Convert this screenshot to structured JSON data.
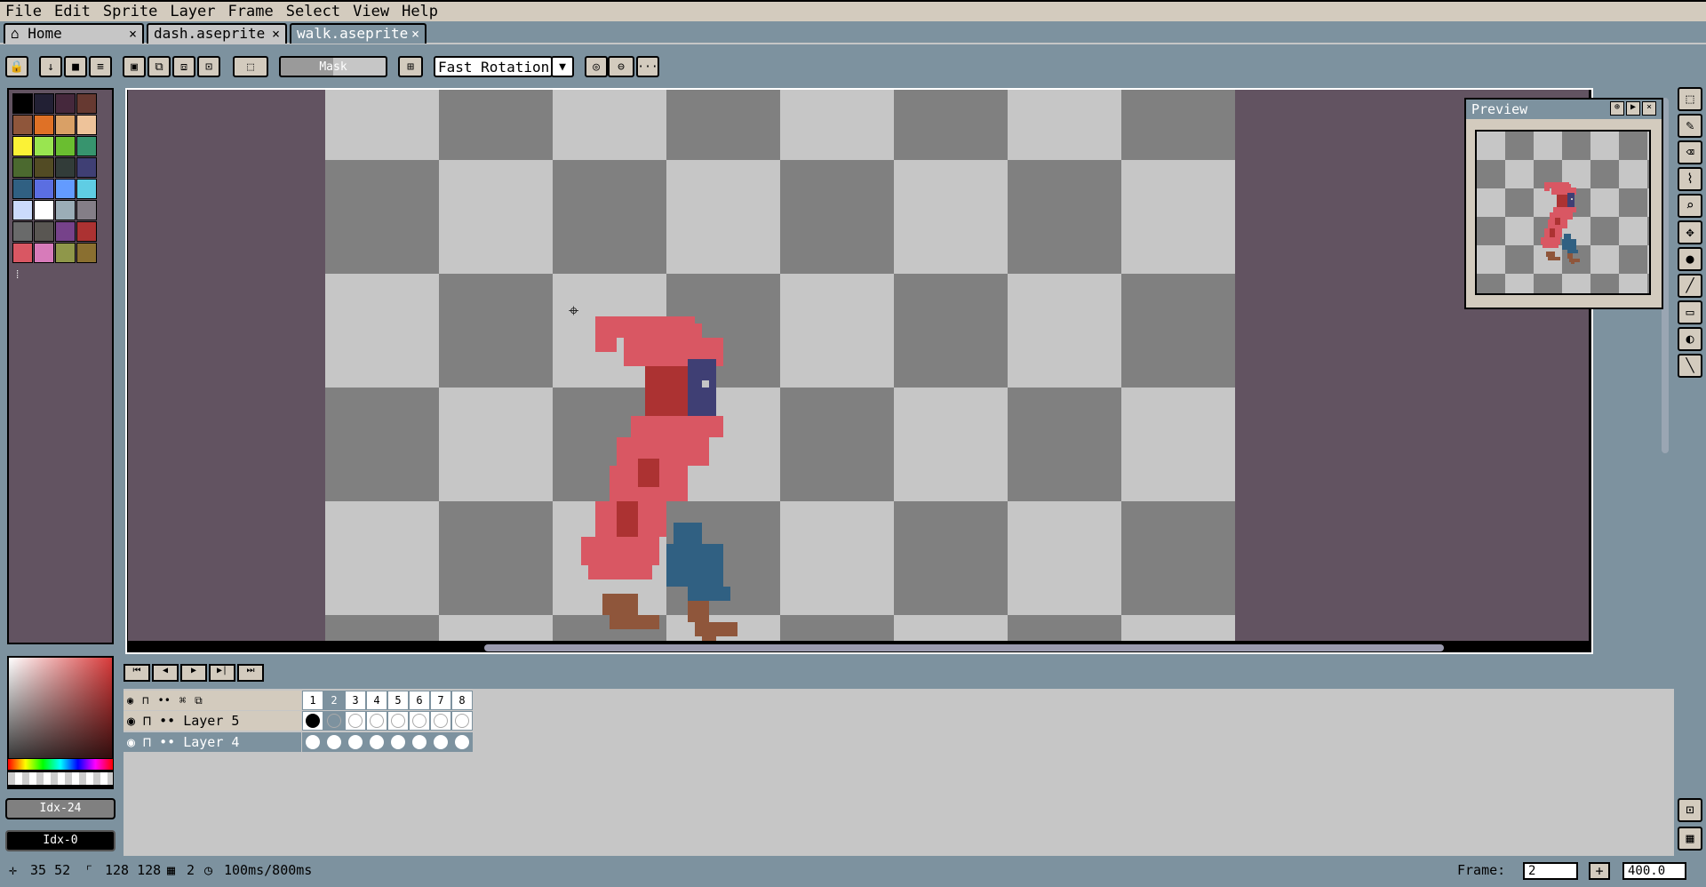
{
  "menu": [
    "File",
    "Edit",
    "Sprite",
    "Layer",
    "Frame",
    "Select",
    "View",
    "Help"
  ],
  "tabs": [
    {
      "label": "Home",
      "icon": "home-icon",
      "close": "×"
    },
    {
      "label": "dash.aseprite",
      "close": "×"
    },
    {
      "label": "walk.aseprite",
      "close": "×",
      "active": true
    }
  ],
  "toolbar": {
    "mask_label": "Mask",
    "rotation_value": "Fast Rotation",
    "more_label": "···"
  },
  "preview": {
    "title": "Preview"
  },
  "palette_colors": [
    "#000000",
    "#222034",
    "#45283c",
    "#663931",
    "#8f563b",
    "#df7126",
    "#d9a066",
    "#eec39a",
    "#fbf236",
    "#99e550",
    "#6abe30",
    "#37946e",
    "#4b692f",
    "#524b24",
    "#323c39",
    "#3f3f74",
    "#306082",
    "#5b6ee1",
    "#639bff",
    "#5fcde4",
    "#cbdbfc",
    "#ffffff",
    "#9badb7",
    "#847e87",
    "#696a6a",
    "#595652",
    "#76428a",
    "#ac3232",
    "#d95763",
    "#d77bba",
    "#8f974a",
    "#8a6f30"
  ],
  "color_bar": {
    "fg_label": "Idx-24",
    "bg_label": "Idx-0"
  },
  "timeline": {
    "frames": [
      "1",
      "2",
      "3",
      "4",
      "5",
      "6",
      "7",
      "8"
    ],
    "layers": [
      {
        "name": "Layer 5",
        "cels": [
          true,
          false,
          false,
          false,
          false,
          false,
          false,
          false
        ]
      },
      {
        "name": "Layer 4",
        "cels": [
          true,
          true,
          true,
          true,
          true,
          true,
          true,
          true
        ],
        "selected": true
      }
    ],
    "current_frame": "2"
  },
  "status": {
    "position": "35 52",
    "size": "128 128",
    "frames_count": "2",
    "duration": "100ms/800ms",
    "frame_label": "Frame:",
    "frame_value": "2",
    "zoom_value": "400.0"
  },
  "colors": {
    "accent": "#7d929f",
    "canvas_bg": "#625361",
    "checker_light": "#c6c6c6",
    "checker_dark": "#808080",
    "cloak": "#d95763",
    "cloak_dark": "#ac3232",
    "face": "#3f3f74",
    "pants": "#306082",
    "boots": "#8f563b"
  }
}
